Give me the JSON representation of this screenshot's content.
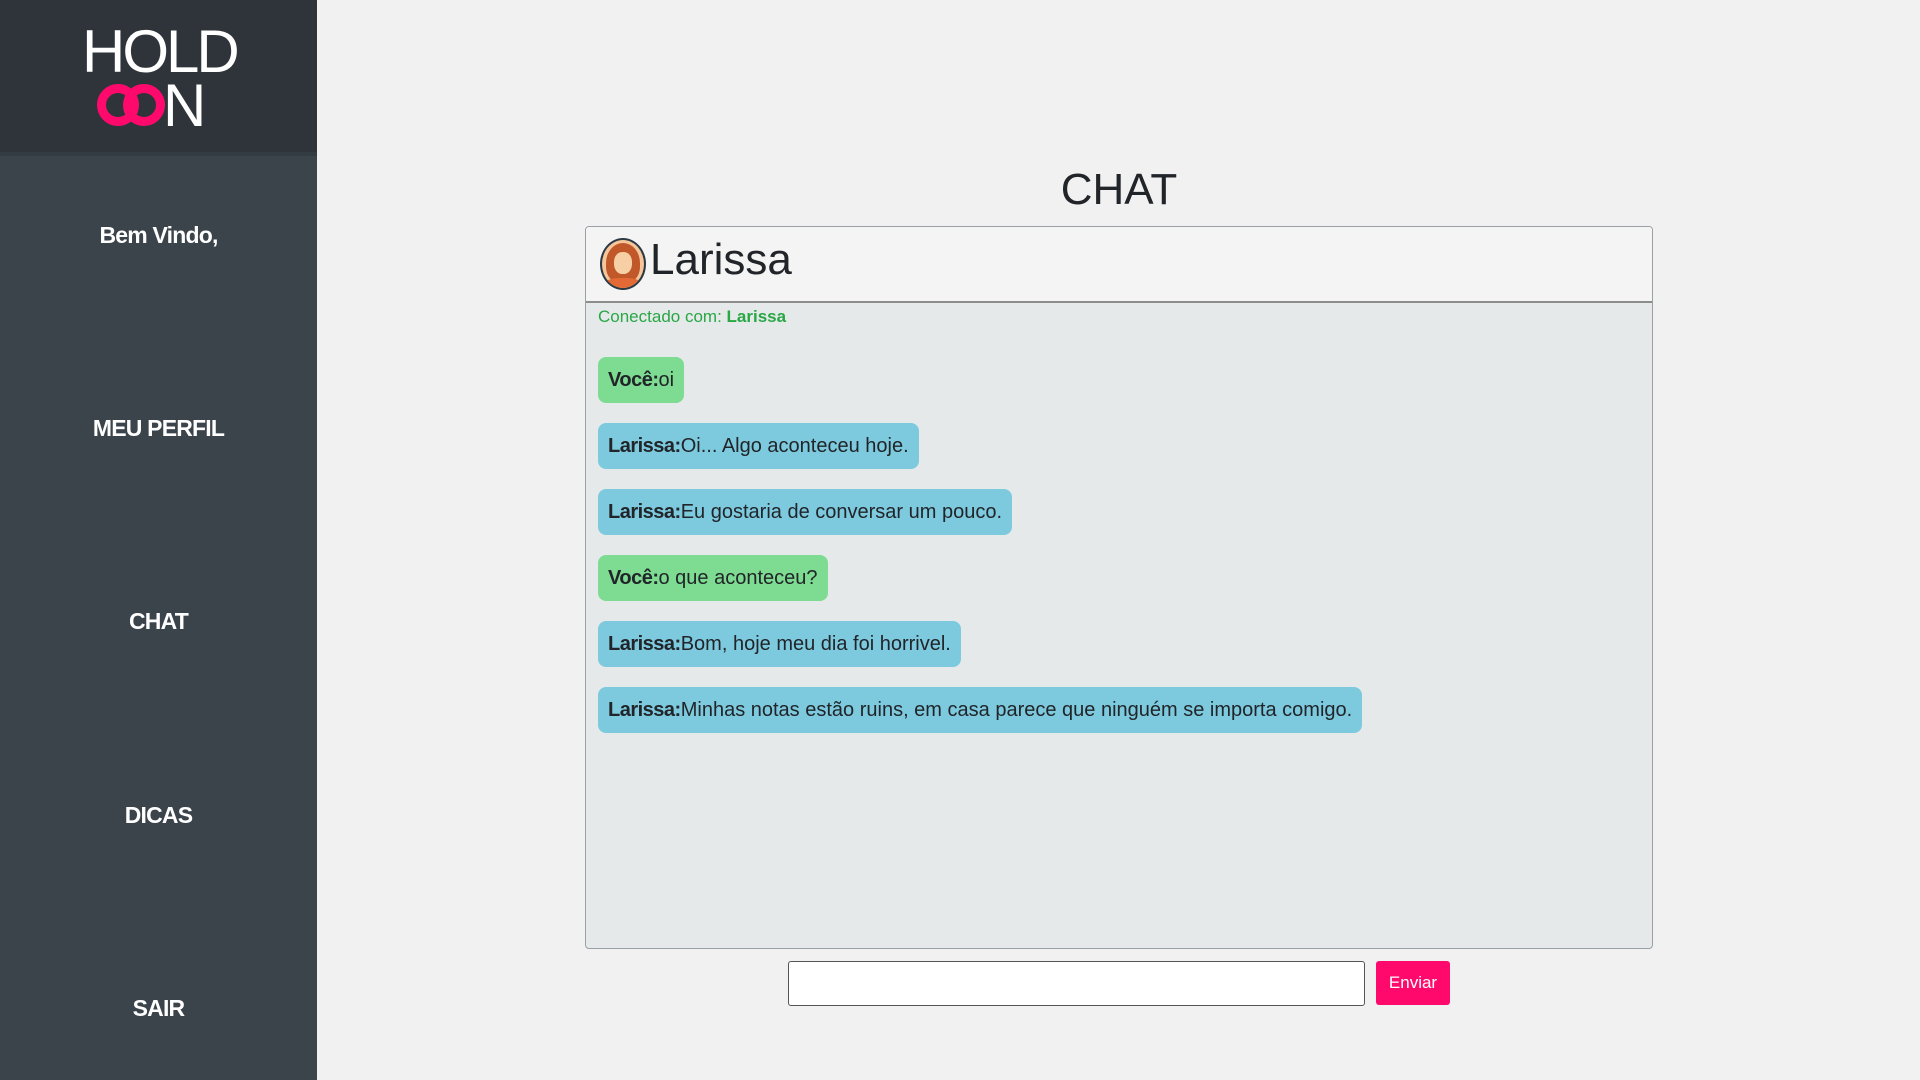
{
  "logo": {
    "top": "HOLD",
    "bottom_letter": "N"
  },
  "sidebar": {
    "welcome": "Bem Vindo,",
    "items": [
      {
        "label": "MEU PERFIL"
      },
      {
        "label": "CHAT"
      },
      {
        "label": "DICAS"
      },
      {
        "label": "SAIR"
      }
    ]
  },
  "page": {
    "title": "CHAT"
  },
  "chat": {
    "contact_name": "Larissa",
    "connected_label": "Conectado com:",
    "connected_name": "Larissa",
    "messages": [
      {
        "sender": "Você:",
        "text": "oi",
        "from": "me"
      },
      {
        "sender": "Larissa:",
        "text": "Oi... Algo aconteceu hoje.",
        "from": "them"
      },
      {
        "sender": "Larissa:",
        "text": "Eu gostaria de conversar um pouco.",
        "from": "them"
      },
      {
        "sender": "Você:",
        "text": "o que aconteceu?",
        "from": "me"
      },
      {
        "sender": "Larissa:",
        "text": "Bom, hoje meu dia foi horrivel.",
        "from": "them"
      },
      {
        "sender": "Larissa:",
        "text": "Minhas notas estão ruins, em casa parece que ninguém se importa comigo.",
        "from": "them"
      }
    ]
  },
  "composer": {
    "input_value": "",
    "send_label": "Enviar"
  },
  "colors": {
    "accent": "#ff0a6c",
    "sidebar": "#3b434b",
    "me_bubble": "#7ddc91",
    "them_bubble": "#7dcadf",
    "connected": "#28a745"
  }
}
